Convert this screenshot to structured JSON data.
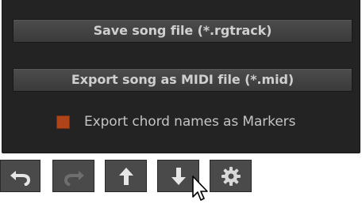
{
  "dialog": {
    "save_button_label": "Save song file (*.rgtrack)",
    "export_midi_button_label": "Export song as MIDI file (*.mid)",
    "export_chords_checkbox": {
      "label": "Export chord names as Markers",
      "checked": true,
      "color": "#b04419"
    }
  },
  "toolbar": {
    "buttons": [
      {
        "icon": "undo-icon",
        "enabled": true
      },
      {
        "icon": "redo-icon",
        "enabled": false
      },
      {
        "icon": "arrow-up-icon",
        "enabled": true
      },
      {
        "icon": "arrow-down-icon",
        "enabled": true
      },
      {
        "icon": "gear-icon",
        "enabled": true
      }
    ]
  },
  "colors": {
    "panel_background": "#232323",
    "button_text": "#cfcfcf",
    "checkbox_accent": "#b04419",
    "toolbar_button": "#4a4a4a"
  }
}
